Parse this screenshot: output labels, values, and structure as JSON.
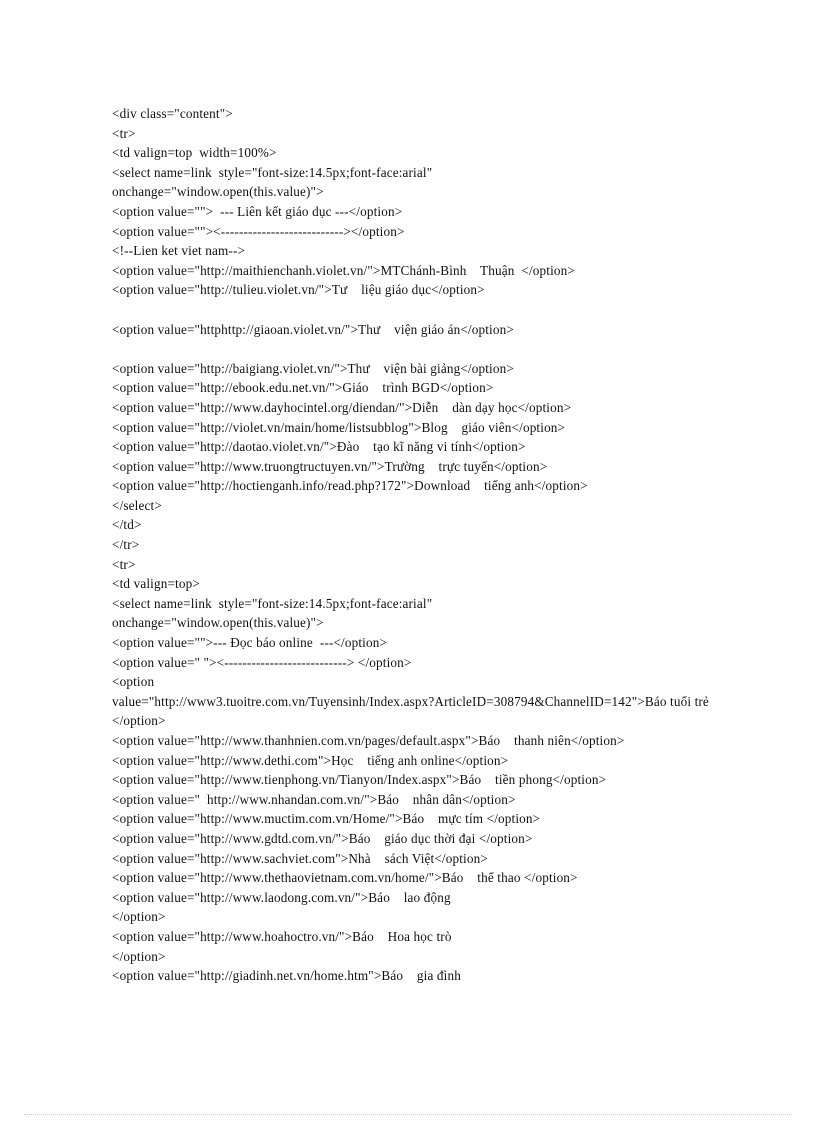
{
  "document": {
    "kind": "scanned-source-code-listing",
    "page_background": "#ffffff",
    "text_color": "#111111",
    "footer_rule_color": "#c9c9c9",
    "code_lines": [
      "<div class=\"content\">",
      "<tr>",
      "<td valign=top  width=100%>",
      "<select name=link  style=\"font-size:14.5px;font-face:arial\"",
      "onchange=\"window.open(this.value)\">",
      "<option value=\"\">  --- Liên kết giáo dục ---</option>",
      "<option value=\"\"><---------------------------></option>",
      "<!--Lien ket viet nam-->",
      "<option value=\"http://maithienchanh.violet.vn/\">MTChánh-Bình    Thuận  </option>",
      "<option value=\"http://tulieu.violet.vn/\">Tư    liệu giáo dục</option>",
      "",
      "<option value=\"httphttp://giaoan.violet.vn/\">Thư    viện giáo án</option>",
      "",
      "<option value=\"http://baigiang.violet.vn/\">Thư    viện bài giảng</option>",
      "<option value=\"http://ebook.edu.net.vn/\">Giáo    trình BGD</option>",
      "<option value=\"http://www.dayhocintel.org/diendan/\">Diễn    dàn dạy học</option>",
      "<option value=\"http://violet.vn/main/home/listsubblog\">Blog    giáo viên</option>",
      "<option value=\"http://daotao.violet.vn/\">Đào    tạo kĩ năng vi tính</option>",
      "<option value=\"http://www.truongtructuyen.vn/\">Trường    trực tuyến</option>",
      "<option value=\"http://hoctienganh.info/read.php?172\">Download    tiếng anh</option>",
      "</select>",
      "</td>",
      "</tr>",
      "<tr>",
      "<td valign=top>",
      "<select name=link  style=\"font-size:14.5px;font-face:arial\"",
      "onchange=\"window.open(this.value)\">",
      "<option value=\"\">--- Đọc báo online  ---</option>",
      "<option value=\" \"><---------------------------> </option>",
      "<option",
      "value=\"http://www3.tuoitre.com.vn/Tuyensinh/Index.aspx?ArticleID=308794&ChannelID=142\">Báo tuổi trẻ </option>",
      "<option value=\"http://www.thanhnien.com.vn/pages/default.aspx\">Báo    thanh niên</option>",
      "<option value=\"http://www.dethi.com\">Học    tiếng anh online</option>",
      "<option value=\"http://www.tienphong.vn/Tianyon/Index.aspx\">Báo    tiền phong</option>",
      "<option value=\"  http://www.nhandan.com.vn/\">Báo    nhân dân</option>",
      "<option value=\"http://www.muctim.com.vn/Home/\">Báo    mực tím </option>",
      "<option value=\"http://www.gdtd.com.vn/\">Báo    giáo dục thời đại </option>",
      "<option value=\"http://www.sachviet.com\">Nhà    sách Việt</option>",
      "<option value=\"http://www.thethaovietnam.com.vn/home/\">Báo    thể thao </option>",
      "<option value=\"http://www.laodong.com.vn/\">Báo    lao động",
      "</option>",
      "<option value=\"http://www.hoahoctro.vn/\">Báo    Hoa học trò",
      "</option>",
      "<option value=\"http://giadinh.net.vn/home.htm\">Báo    gia đình"
    ]
  }
}
